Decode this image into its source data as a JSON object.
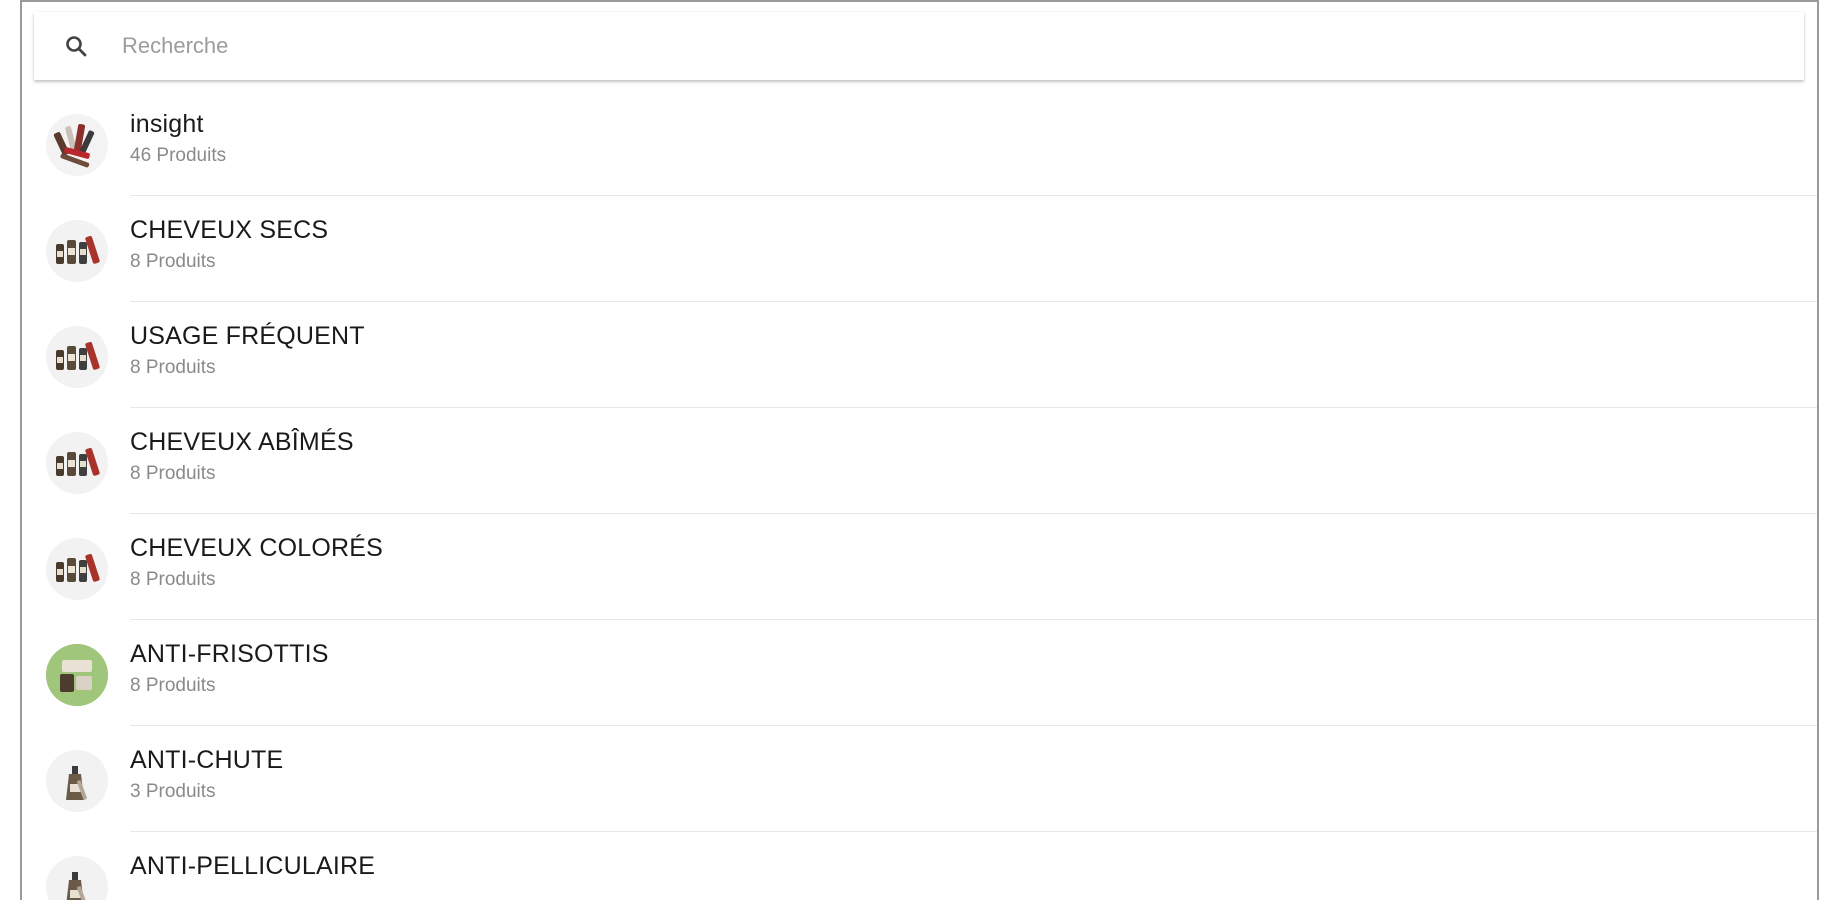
{
  "search": {
    "placeholder": "Recherche",
    "icon": "search-icon"
  },
  "categories": [
    {
      "title": "insight",
      "subtitle": "46 Produits",
      "thumb": "multi-products-thumbnail",
      "thumb_bg": "#f3f3f3"
    },
    {
      "title": "CHEVEUX SECS",
      "subtitle": "8 Produits",
      "thumb": "bottles-thumbnail",
      "thumb_bg": "#f2f2f2"
    },
    {
      "title": "USAGE FRÉQUENT",
      "subtitle": "8 Produits",
      "thumb": "bottles-thumbnail",
      "thumb_bg": "#f2f2f2"
    },
    {
      "title": "CHEVEUX ABÎMÉS",
      "subtitle": "8 Produits",
      "thumb": "bottles-thumbnail",
      "thumb_bg": "#f2f2f2"
    },
    {
      "title": "CHEVEUX COLORÉS",
      "subtitle": "8 Produits",
      "thumb": "bottles-thumbnail",
      "thumb_bg": "#f2f2f2"
    },
    {
      "title": "ANTI-FRISOTTIS",
      "subtitle": "8 Produits",
      "thumb": "green-products-thumbnail",
      "thumb_bg": "#9fc67a"
    },
    {
      "title": "ANTI-CHUTE",
      "subtitle": "3 Produits",
      "thumb": "bottle-thumbnail",
      "thumb_bg": "#f2f2f2"
    },
    {
      "title": "ANTI-PELLICULAIRE",
      "subtitle": "",
      "thumb": "bottle-thumbnail",
      "thumb_bg": "#f2f2f2"
    }
  ]
}
